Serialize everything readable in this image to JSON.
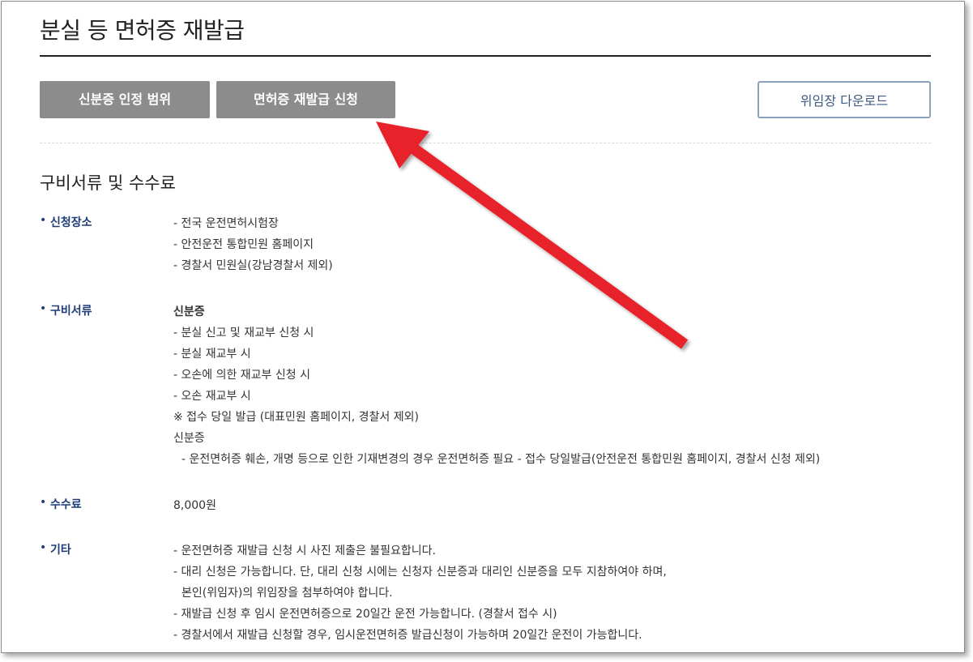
{
  "page_title": "분실 등 면허증 재발급",
  "buttons": {
    "id_scope": "신분증 인정 범위",
    "reissue_apply": "면허증 재발급 신청",
    "proxy_download": "위임장 다운로드"
  },
  "section_title": "구비서류 및 수수료",
  "rows": [
    {
      "bullet": "•",
      "label": "신청장소",
      "lines": [
        "- 전국 운전면허시험장",
        "- 안전운전 통합민원 홈페이지",
        "- 경찰서 민원실(강남경찰서 제외)"
      ]
    },
    {
      "bullet": "•",
      "label": "구비서류",
      "lines": [
        "신분증",
        "- 분실 신고 및 재교부 신청 시",
        "- 분실 재교부 시",
        "- 오손에 의한 재교부 신청 시",
        "- 오손 재교부 시",
        "※ 접수 당일 발급 (대표민원 홈페이지, 경찰서 제외)",
        "신분증",
        "- 운전면허증 훼손, 개명 등으로 인한 기재변경의 경우 운전면허증 필요 - 접수 당일발급(안전운전 통합민원 홈페이지, 경찰서 신청 제외)"
      ]
    },
    {
      "bullet": "•",
      "label": "수수료",
      "lines": [
        "8,000원"
      ]
    },
    {
      "bullet": "•",
      "label": "기타",
      "lines": [
        "- 운전면허증 재발급 신청 시 사진 제출은 불필요합니다.",
        "- 대리 신청은 가능합니다. 단, 대리 신청 시에는 신청자 신분증과 대리인 신분증을 모두 지참하여야 하며,",
        "본인(위임자)의 위임장을 첨부하여야 합니다.",
        "- 재발급 신청 후 임시 운전면허증으로 20일간 운전 가능합니다. (경찰서 접수 시)",
        "- 경찰서에서 재발급 신청할 경우, 임시운전면허증 발급신청이 가능하며 20일간 운전이 가능합니다."
      ]
    }
  ],
  "colors": {
    "accent_label": "#1d3c78",
    "gray_button": "#8c8c8c",
    "outline_button_border": "#8aa0bd",
    "annotation_arrow": "#e8232a"
  }
}
